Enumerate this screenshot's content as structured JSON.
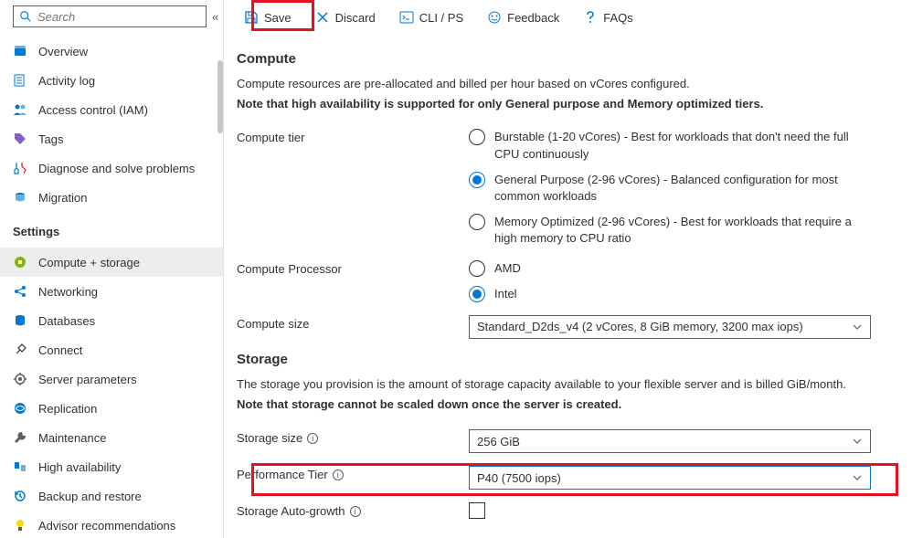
{
  "search": {
    "placeholder": "Search"
  },
  "sidebar": {
    "items": [
      {
        "label": "Overview"
      },
      {
        "label": "Activity log"
      },
      {
        "label": "Access control (IAM)"
      },
      {
        "label": "Tags"
      },
      {
        "label": "Diagnose and solve problems"
      },
      {
        "label": "Migration"
      }
    ],
    "settings_head": "Settings",
    "settings": [
      {
        "label": "Compute + storage"
      },
      {
        "label": "Networking"
      },
      {
        "label": "Databases"
      },
      {
        "label": "Connect"
      },
      {
        "label": "Server parameters"
      },
      {
        "label": "Replication"
      },
      {
        "label": "Maintenance"
      },
      {
        "label": "High availability"
      },
      {
        "label": "Backup and restore"
      },
      {
        "label": "Advisor recommendations"
      }
    ]
  },
  "toolbar": {
    "save": "Save",
    "discard": "Discard",
    "cli": "CLI / PS",
    "feedback": "Feedback",
    "faqs": "FAQs"
  },
  "compute": {
    "title": "Compute",
    "desc": "Compute resources are pre-allocated and billed per hour based on vCores configured.",
    "note": "Note that high availability is supported for only General purpose and Memory optimized tiers.",
    "tier_label": "Compute tier",
    "tiers": [
      "Burstable (1-20 vCores) - Best for workloads that don't need the full CPU continuously",
      "General Purpose (2-96 vCores) - Balanced configuration for most common workloads",
      "Memory Optimized (2-96 vCores) - Best for workloads that require a high memory to CPU ratio"
    ],
    "proc_label": "Compute Processor",
    "procs": [
      "AMD",
      "Intel"
    ],
    "size_label": "Compute size",
    "size_value": "Standard_D2ds_v4 (2 vCores, 8 GiB memory, 3200 max iops)"
  },
  "storage": {
    "title": "Storage",
    "desc": "The storage you provision is the amount of storage capacity available to your flexible server and is billed GiB/month.",
    "note": "Note that storage cannot be scaled down once the server is created.",
    "size_label": "Storage size",
    "size_value": "256 GiB",
    "perf_label": "Performance Tier",
    "perf_value": "P40 (7500 iops)",
    "autogrow_label": "Storage Auto-growth"
  }
}
